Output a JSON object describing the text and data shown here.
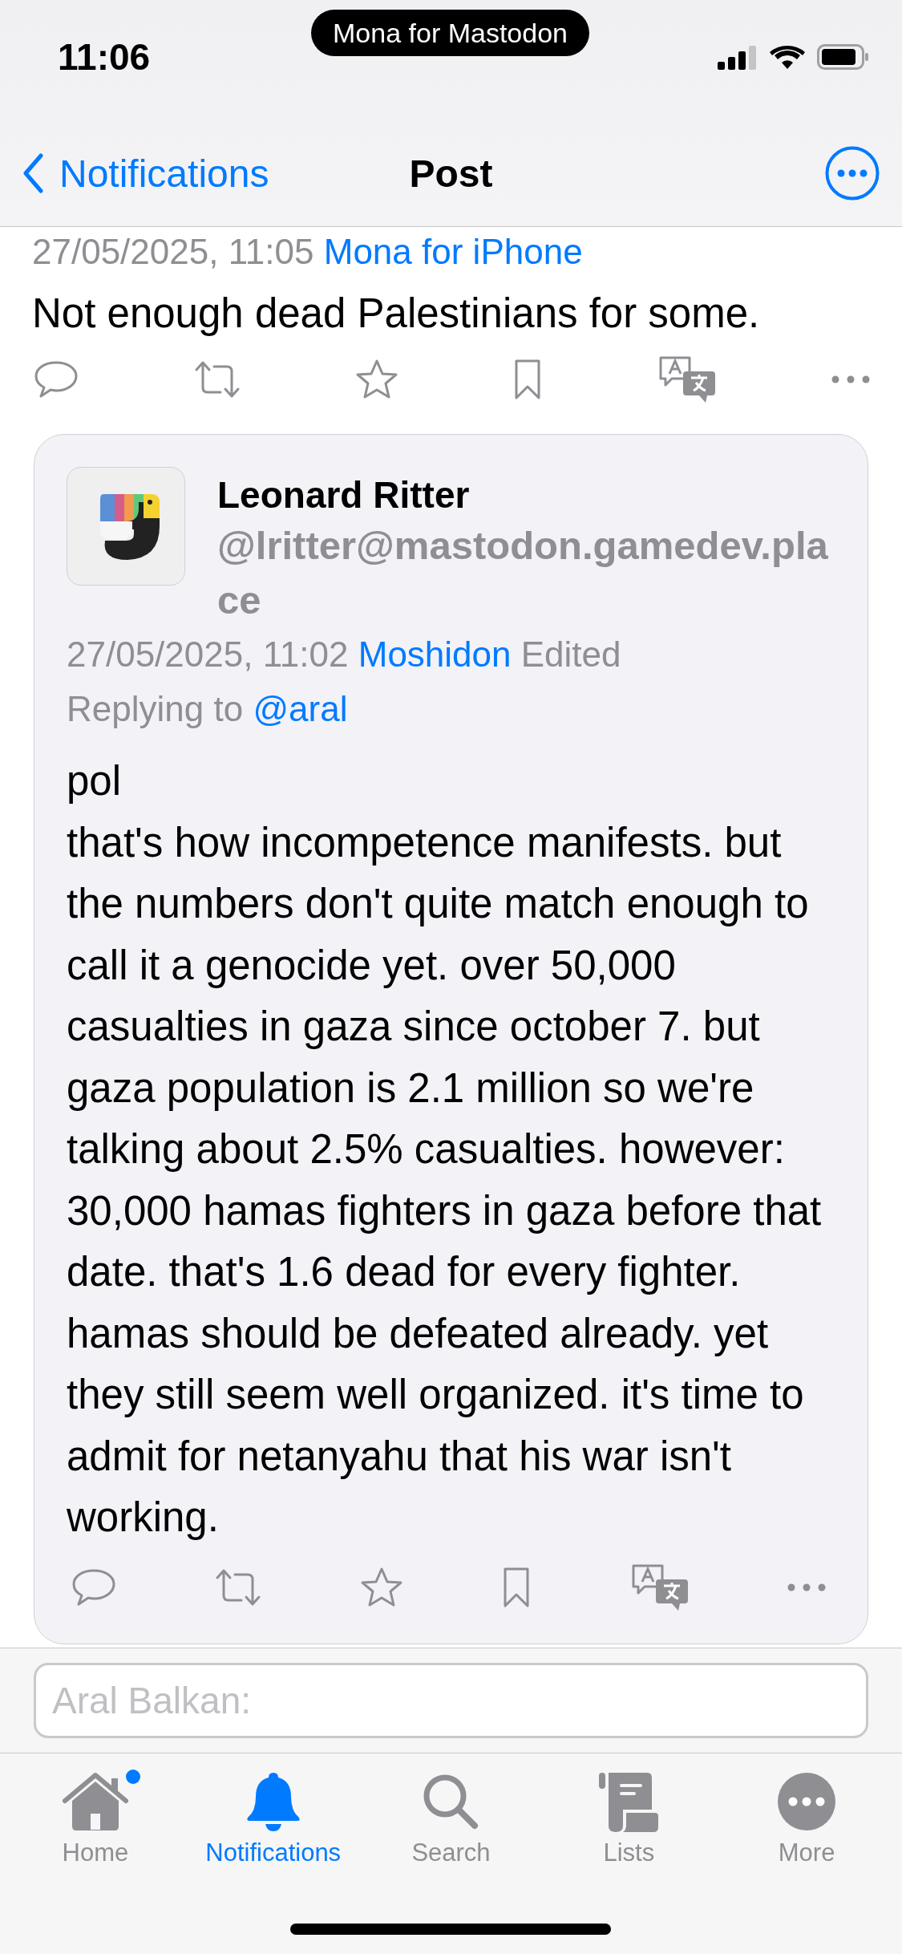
{
  "status_bar": {
    "time": "11:06",
    "app_pill": "Mona for Mastodon"
  },
  "nav_bar": {
    "back_label": "Notifications",
    "title": "Post"
  },
  "post": {
    "timestamp": "27/05/2025, 11:05",
    "client": "Mona for iPhone",
    "text": "Not enough dead Palestinians for some."
  },
  "quoted_reply": {
    "display_name": "Leonard Ritter",
    "handle": "@lritter@mastodon.gamedev.place",
    "timestamp": "27/05/2025, 11:02",
    "client": "Moshidon",
    "edited_label": "Edited",
    "replying_prefix": "Replying to",
    "reply_mention": "@aral",
    "body": "pol\nthat's how incompetence manifests. but the numbers don't quite match enough to call it a genocide yet. over 50,000 casualties in gaza since october 7. but gaza population is 2.1 million so we're talking about 2.5% casualties. however: 30,000 hamas fighters in gaza before that date. that's 1.6 dead for every fighter. hamas should be defeated already. yet they still seem well organized. it's time to admit for netanyahu that his war isn't working."
  },
  "compose": {
    "placeholder": "Aral Balkan:"
  },
  "tab_bar": [
    {
      "kind": "home",
      "label": "Home",
      "selected": false,
      "badge": true
    },
    {
      "kind": "bell",
      "label": "Notifications",
      "selected": true,
      "badge": false
    },
    {
      "kind": "search",
      "label": "Search",
      "selected": false,
      "badge": false
    },
    {
      "kind": "lists",
      "label": "Lists",
      "selected": false,
      "badge": false
    },
    {
      "kind": "more",
      "label": "More",
      "selected": false,
      "badge": false
    }
  ]
}
